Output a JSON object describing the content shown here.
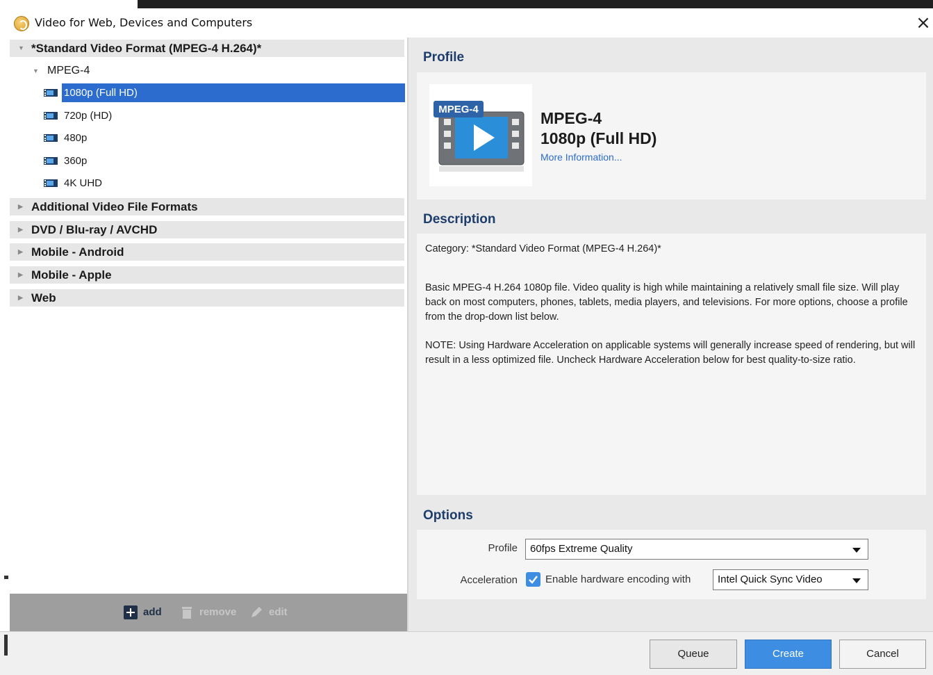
{
  "window": {
    "title": "Video for Web, Devices and Computers",
    "close_icon": "close-icon"
  },
  "tree": {
    "root_category": "*Standard Video Format (MPEG-4 H.264)*",
    "subgroup": "MPEG-4",
    "presets": [
      {
        "label": "1080p (Full HD)",
        "selected": true
      },
      {
        "label": "720p (HD)",
        "selected": false
      },
      {
        "label": "480p",
        "selected": false
      },
      {
        "label": "360p",
        "selected": false
      },
      {
        "label": "4K UHD",
        "selected": false
      }
    ],
    "categories": [
      "Additional Video File Formats",
      "DVD / Blu-ray / AVCHD",
      "Mobile - Android",
      "Mobile - Apple",
      "Web"
    ]
  },
  "toolbar": {
    "add_label": "add",
    "remove_label": "remove",
    "edit_label": "edit"
  },
  "profile": {
    "heading": "Profile",
    "badge": "MPEG-4",
    "format": "MPEG-4",
    "name": "1080p (Full HD)",
    "more_info": "More Information..."
  },
  "description": {
    "heading": "Description",
    "category": "Category: *Standard Video Format (MPEG-4 H.264)*",
    "body": "Basic MPEG-4 H.264 1080p file. Video quality is high while maintaining a relatively small file size. Will play back on most computers, phones, tablets, media players, and televisions. For more options, choose a profile from the drop-down list below.",
    "note": "NOTE: Using Hardware Acceleration on applicable systems will generally increase speed of rendering, but will result in a less optimized file. Uncheck Hardware Acceleration below for best quality-to-size ratio."
  },
  "options": {
    "heading": "Options",
    "profile_label": "Profile",
    "profile_value": "60fps Extreme Quality",
    "acceleration_label": "Acceleration",
    "hw_checkbox_checked": true,
    "hw_checkbox_label": "Enable hardware encoding with",
    "hw_encoder_value": "Intel Quick Sync Video"
  },
  "buttons": {
    "queue": "Queue",
    "create": "Create",
    "cancel": "Cancel"
  },
  "colors": {
    "selection": "#2b6cce",
    "primary_button": "#3d8ee3",
    "heading_text": "#1e3d6b",
    "link": "#2b6cce"
  }
}
